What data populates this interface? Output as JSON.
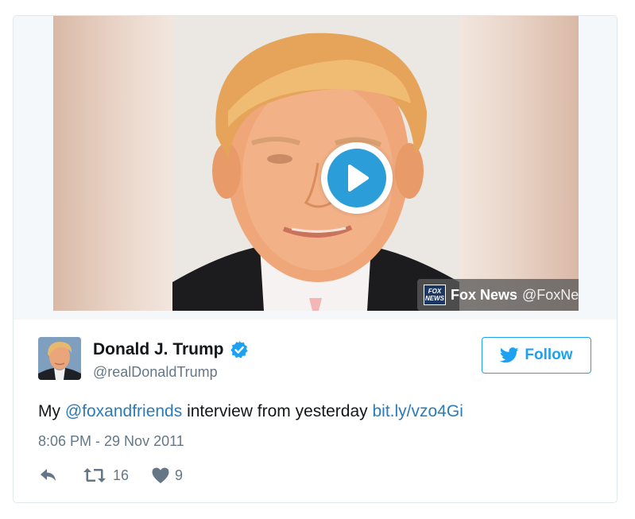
{
  "media": {
    "play_icon": "play-icon",
    "attribution": {
      "logo_line1": "FOX",
      "logo_line2": "NEWS",
      "name": "Fox News",
      "handle": "@FoxNews"
    }
  },
  "author": {
    "name": "Donald J. Trump",
    "handle": "@realDonaldTrump",
    "verified_icon": "verified-badge-icon"
  },
  "follow_button": {
    "label": "Follow",
    "icon": "twitter-bird-icon"
  },
  "tweet": {
    "text_before": "My ",
    "mention": "@foxandfriends",
    "text_middle": " interview from yesterday ",
    "link": "bit.ly/vzo4Gi"
  },
  "timestamp": "8:06 PM - 29 Nov 2011",
  "actions": {
    "reply_icon": "reply-icon",
    "retweet_icon": "retweet-icon",
    "retweet_count": "16",
    "like_icon": "heart-icon",
    "like_count": "9"
  },
  "colors": {
    "accent": "#1da1f2",
    "link": "#2b7bb9",
    "secondary_text": "#657786",
    "play_button": "#2b9ed9"
  }
}
